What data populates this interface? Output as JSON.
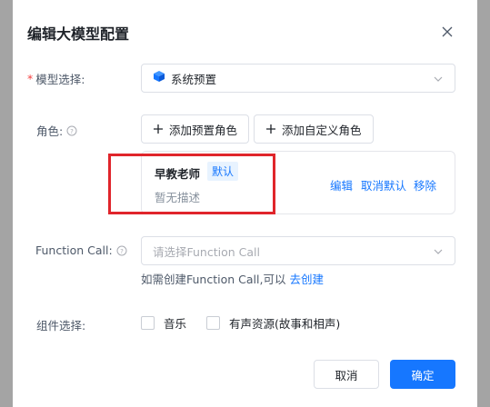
{
  "dialog": {
    "title": "编辑大模型配置"
  },
  "model": {
    "label": "模型选择:",
    "required_mark": "*",
    "value": "系统预置"
  },
  "role": {
    "label": "角色:",
    "add_preset_label": "添加预置角色",
    "add_custom_label": "添加自定义角色",
    "card": {
      "name": "早教老师",
      "badge": "默认",
      "description": "暂无描述",
      "edit_label": "编辑",
      "unset_default_label": "取消默认",
      "remove_label": "移除"
    }
  },
  "function_call": {
    "label": "Function Call:",
    "placeholder": "请选择Function Call",
    "hint_text": "如需创建Function Call,可以",
    "hint_link": "去创建"
  },
  "components": {
    "label": "组件选择:",
    "options": [
      "音乐",
      "有声资源(故事和相声)"
    ]
  },
  "footer": {
    "cancel_label": "取消",
    "ok_label": "确定"
  },
  "colors": {
    "primary": "#1677ff",
    "highlight_box": "#e0252b",
    "required": "#f53f3f"
  }
}
